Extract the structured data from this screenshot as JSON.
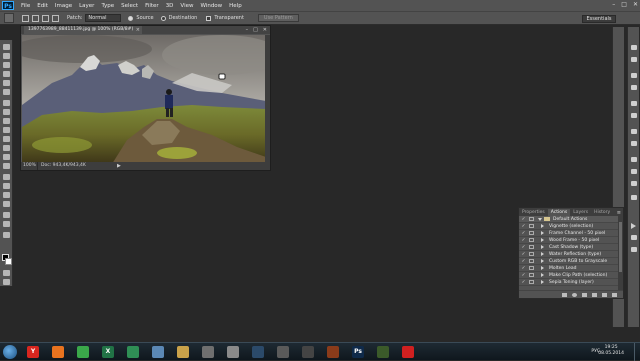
{
  "app": {
    "logo": "Ps",
    "menu": [
      "File",
      "Edit",
      "Image",
      "Layer",
      "Type",
      "Select",
      "Filter",
      "3D",
      "View",
      "Window",
      "Help"
    ],
    "window_controls": [
      "–",
      "□",
      "✕"
    ]
  },
  "options": {
    "patch_label": "Patch:",
    "patch_value": "Normal",
    "source_label": "Source",
    "destination_label": "Destination",
    "transparent_label": "Transparent",
    "use_pattern_label": "Use Pattern",
    "workspace": "Essentials"
  },
  "document": {
    "tab_title": "1397763989_88411139.jpg @ 100% (RGB/8#)",
    "tab_close": "×",
    "win_buttons": [
      "–",
      "□",
      "✕"
    ],
    "zoom": "100%",
    "doc_info": "Doc: 943,4K/943,4K",
    "status_arrow": "▶"
  },
  "actions_panel": {
    "tabs": [
      "Properties",
      "Actions",
      "Layers",
      "History"
    ],
    "active_tab": "Actions",
    "menu_icon": "≡",
    "set_name": "Default Actions",
    "items": [
      "Vignette (selection)",
      "Frame Channel - 50 pixel",
      "Wood Frame - 50 pixel",
      "Cast Shadow (type)",
      "Water Reflection (type)",
      "Custom RGB to Grayscale",
      "Molten Lead",
      "Make Clip Path (selection)",
      "Sepia Toning (layer)"
    ],
    "check": "✓"
  },
  "taskbar": {
    "time": "19:25",
    "date": "08.05.2014",
    "lang": "РУС",
    "apps": [
      {
        "icon": "yandex-icon",
        "text": "Y",
        "color": "#d8261f"
      },
      {
        "icon": "firefox-icon",
        "text": "",
        "color": "#e8731f"
      },
      {
        "icon": "chrome-icon",
        "text": "",
        "color": "#3aa84a"
      },
      {
        "icon": "excel-icon",
        "text": "X",
        "color": "#217346"
      },
      {
        "icon": "kaspersky-icon",
        "text": "",
        "color": "#2f8f55"
      },
      {
        "icon": "volume-icon",
        "text": "",
        "color": "#5b88b5"
      },
      {
        "icon": "folder-icon",
        "text": "",
        "color": "#c9a24a"
      },
      {
        "icon": "assassins-creed-icon",
        "text": "",
        "color": "#6f6f6f"
      },
      {
        "icon": "ac-rogue-icon",
        "text": "",
        "color": "#8a8a8a"
      },
      {
        "icon": "steam-icon",
        "text": "",
        "color": "#2b4a6a"
      },
      {
        "icon": "wolf-game-icon",
        "text": "",
        "color": "#5a5a5a"
      },
      {
        "icon": "cod-icon",
        "text": "",
        "color": "#444"
      },
      {
        "icon": "game-icon",
        "text": "",
        "color": "#8a3b1a"
      },
      {
        "icon": "photoshop-icon",
        "text": "Ps",
        "color": "#0f2a4a"
      },
      {
        "icon": "game2-icon",
        "text": "",
        "color": "#3b5a2a"
      },
      {
        "icon": "record-icon",
        "text": "",
        "color": "#d02020"
      }
    ]
  }
}
